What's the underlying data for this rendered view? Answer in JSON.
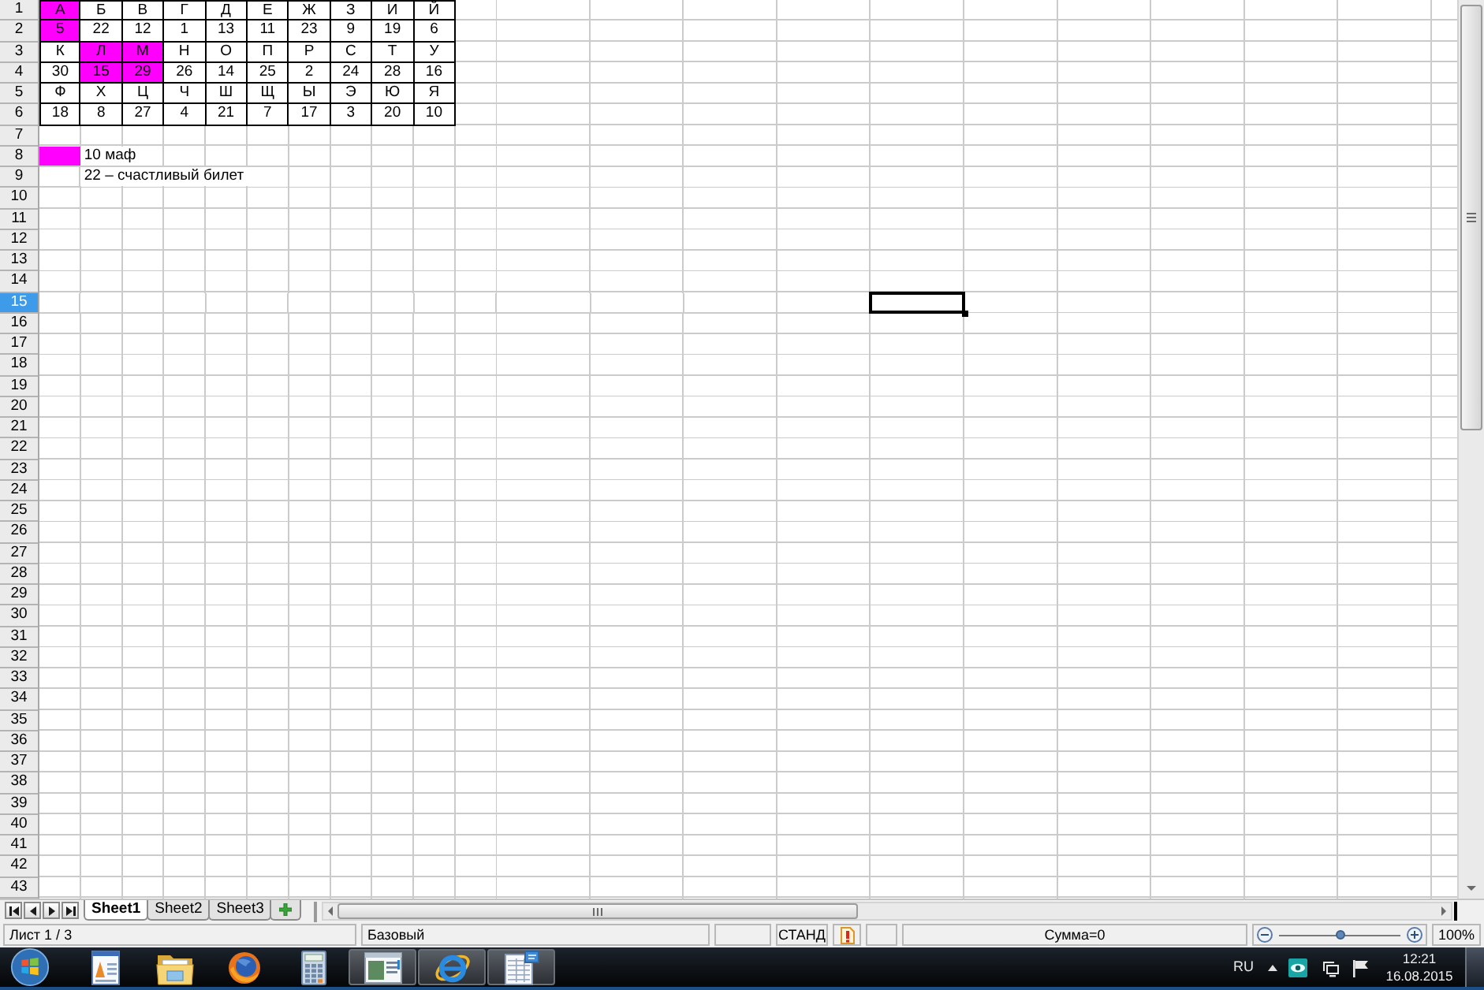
{
  "sheet": {
    "rows": [
      {
        "number": "1",
        "cells": [
          {
            "text": "А",
            "highlighted": true,
            "bordered": true,
            "selected": false
          },
          {
            "text": "Б",
            "highlighted": false,
            "bordered": true,
            "selected": false
          },
          {
            "text": "В",
            "highlighted": false,
            "bordered": true,
            "selected": false
          },
          {
            "text": "Г",
            "highlighted": false,
            "bordered": true,
            "selected": false
          },
          {
            "text": "Д",
            "highlighted": false,
            "bordered": true,
            "selected": false
          },
          {
            "text": "Е",
            "highlighted": false,
            "bordered": true,
            "selected": false
          },
          {
            "text": "Ж",
            "highlighted": false,
            "bordered": true,
            "selected": false
          },
          {
            "text": "З",
            "highlighted": false,
            "bordered": true,
            "selected": false
          },
          {
            "text": "И",
            "highlighted": false,
            "bordered": true,
            "selected": false
          },
          {
            "text": "Й",
            "highlighted": false,
            "bordered": true,
            "selected": false
          }
        ]
      },
      {
        "number": "2",
        "cells": [
          {
            "text": "5",
            "highlighted": true,
            "bordered": true,
            "selected": false
          },
          {
            "text": "22",
            "highlighted": false,
            "bordered": true,
            "selected": false
          },
          {
            "text": "12",
            "highlighted": false,
            "bordered": true,
            "selected": false
          },
          {
            "text": "1",
            "highlighted": false,
            "bordered": true,
            "selected": false
          },
          {
            "text": "13",
            "highlighted": false,
            "bordered": true,
            "selected": false
          },
          {
            "text": "11",
            "highlighted": false,
            "bordered": true,
            "selected": false
          },
          {
            "text": "23",
            "highlighted": false,
            "bordered": true,
            "selected": false
          },
          {
            "text": "9",
            "highlighted": false,
            "bordered": true,
            "selected": false
          },
          {
            "text": "19",
            "highlighted": false,
            "bordered": true,
            "selected": false
          },
          {
            "text": "6",
            "highlighted": false,
            "bordered": true,
            "selected": false
          }
        ]
      },
      {
        "number": "3",
        "cells": [
          {
            "text": "К",
            "highlighted": false,
            "bordered": true,
            "selected": false
          },
          {
            "text": "Л",
            "highlighted": true,
            "bordered": true,
            "selected": false
          },
          {
            "text": "М",
            "highlighted": true,
            "bordered": true,
            "selected": false
          },
          {
            "text": "Н",
            "highlighted": false,
            "bordered": true,
            "selected": false
          },
          {
            "text": "О",
            "highlighted": false,
            "bordered": true,
            "selected": false
          },
          {
            "text": "П",
            "highlighted": false,
            "bordered": true,
            "selected": false
          },
          {
            "text": "Р",
            "highlighted": false,
            "bordered": true,
            "selected": false
          },
          {
            "text": "С",
            "highlighted": false,
            "bordered": true,
            "selected": false
          },
          {
            "text": "Т",
            "highlighted": false,
            "bordered": true,
            "selected": false
          },
          {
            "text": "У",
            "highlighted": false,
            "bordered": true,
            "selected": false
          }
        ]
      },
      {
        "number": "4",
        "cells": [
          {
            "text": "30",
            "highlighted": false,
            "bordered": true,
            "selected": false
          },
          {
            "text": "15",
            "highlighted": true,
            "bordered": true,
            "selected": false
          },
          {
            "text": "29",
            "highlighted": true,
            "bordered": true,
            "selected": false
          },
          {
            "text": "26",
            "highlighted": false,
            "bordered": true,
            "selected": false
          },
          {
            "text": "14",
            "highlighted": false,
            "bordered": true,
            "selected": false
          },
          {
            "text": "25",
            "highlighted": false,
            "bordered": true,
            "selected": false
          },
          {
            "text": "2",
            "highlighted": false,
            "bordered": true,
            "selected": false
          },
          {
            "text": "24",
            "highlighted": false,
            "bordered": true,
            "selected": false
          },
          {
            "text": "28",
            "highlighted": false,
            "bordered": true,
            "selected": false
          },
          {
            "text": "16",
            "highlighted": false,
            "bordered": true,
            "selected": false
          }
        ]
      },
      {
        "number": "5",
        "cells": [
          {
            "text": "Ф",
            "highlighted": false,
            "bordered": true,
            "selected": false
          },
          {
            "text": "Х",
            "highlighted": false,
            "bordered": true,
            "selected": false
          },
          {
            "text": "Ц",
            "highlighted": false,
            "bordered": true,
            "selected": false
          },
          {
            "text": "Ч",
            "highlighted": false,
            "bordered": true,
            "selected": false
          },
          {
            "text": "Ш",
            "highlighted": false,
            "bordered": true,
            "selected": false
          },
          {
            "text": "Щ",
            "highlighted": false,
            "bordered": true,
            "selected": false
          },
          {
            "text": "Ы",
            "highlighted": false,
            "bordered": true,
            "selected": false
          },
          {
            "text": "Э",
            "highlighted": false,
            "bordered": true,
            "selected": false
          },
          {
            "text": "Ю",
            "highlighted": false,
            "bordered": true,
            "selected": false
          },
          {
            "text": "Я",
            "highlighted": false,
            "bordered": true,
            "selected": false
          }
        ]
      },
      {
        "number": "6",
        "cells": [
          {
            "text": "18",
            "highlighted": false,
            "bordered": true,
            "selected": false
          },
          {
            "text": "8",
            "highlighted": false,
            "bordered": true,
            "selected": false
          },
          {
            "text": "27",
            "highlighted": false,
            "bordered": true,
            "selected": false
          },
          {
            "text": "4",
            "highlighted": false,
            "bordered": true,
            "selected": false
          },
          {
            "text": "21",
            "highlighted": false,
            "bordered": true,
            "selected": false
          },
          {
            "text": "7",
            "highlighted": false,
            "bordered": true,
            "selected": false
          },
          {
            "text": "17",
            "highlighted": false,
            "bordered": true,
            "selected": false
          },
          {
            "text": "3",
            "highlighted": false,
            "bordered": true,
            "selected": false
          },
          {
            "text": "20",
            "highlighted": false,
            "bordered": true,
            "selected": false
          },
          {
            "text": "10",
            "highlighted": false,
            "bordered": true,
            "selected": false
          }
        ]
      },
      {
        "number": "7"
      },
      {
        "number": "8",
        "cells": [
          {
            "highlighted": true,
            "bordered": false,
            "selected": false
          },
          {
            "text": "10 маф",
            "highlighted": false,
            "bordered": false,
            "selected": false
          }
        ]
      },
      {
        "number": "9",
        "cells": [
          {
            "highlighted": false,
            "bordered": false,
            "selected": false
          },
          {
            "text": "22 – счастливый билет",
            "highlighted": false,
            "bordered": false,
            "selected": false
          }
        ]
      },
      {
        "number": "10"
      },
      {
        "number": "11"
      },
      {
        "number": "12"
      },
      {
        "number": "13"
      },
      {
        "number": "14"
      },
      {
        "number": "15",
        "cells": [
          {
            "highlighted": false,
            "bordered": false,
            "selected": false
          },
          {
            "highlighted": false,
            "bordered": false,
            "selected": false
          },
          {
            "highlighted": false,
            "bordered": false,
            "selected": false
          },
          {
            "highlighted": false,
            "bordered": false,
            "selected": false
          },
          {
            "highlighted": false,
            "bordered": false,
            "selected": false
          },
          {
            "highlighted": false,
            "bordered": false,
            "selected": false
          },
          {
            "highlighted": false,
            "bordered": false,
            "selected": false
          },
          {
            "highlighted": false,
            "bordered": false,
            "selected": false
          },
          {
            "highlighted": false,
            "bordered": false,
            "selected": false
          },
          {
            "highlighted": false,
            "bordered": false,
            "selected": false
          },
          {
            "highlighted": false,
            "bordered": false,
            "selected": false
          },
          {
            "highlighted": false,
            "bordered": false,
            "selected": false
          },
          {
            "highlighted": false,
            "bordered": false,
            "selected": false
          },
          {
            "highlighted": false,
            "bordered": false,
            "selected": false
          },
          {
            "highlighted": false,
            "bordered": false,
            "selected": false
          },
          {
            "highlighted": false,
            "bordered": false,
            "selected": true
          }
        ]
      },
      {
        "number": "16"
      },
      {
        "number": "17"
      },
      {
        "number": "18"
      },
      {
        "number": "19"
      },
      {
        "number": "20"
      },
      {
        "number": "21"
      },
      {
        "number": "22"
      },
      {
        "number": "23"
      },
      {
        "number": "24"
      },
      {
        "number": "25"
      },
      {
        "number": "26"
      },
      {
        "number": "27"
      },
      {
        "number": "28"
      },
      {
        "number": "29"
      },
      {
        "number": "30"
      },
      {
        "number": "31"
      },
      {
        "number": "32"
      },
      {
        "number": "33"
      },
      {
        "number": "34"
      },
      {
        "number": "35"
      },
      {
        "number": "36"
      },
      {
        "number": "37"
      },
      {
        "number": "38"
      },
      {
        "number": "39"
      },
      {
        "number": "40"
      },
      {
        "number": "41"
      },
      {
        "number": "42"
      },
      {
        "number": "43"
      }
    ]
  },
  "sheet_tabs": [
    {
      "label": "Sheet1",
      "selected": true
    },
    {
      "label": "Sheet2",
      "selected": false
    },
    {
      "label": "Sheet3",
      "selected": false
    }
  ],
  "status_bar": {
    "sheet_position": "Лист 1 / 3",
    "page_style": "Базовый",
    "selection_mode": "СТАНД",
    "modified": true,
    "sum": "Сумма=0",
    "zoom": {
      "level": 0.5,
      "reading": "100%"
    }
  },
  "taskbar": {
    "apps": [
      {
        "kind": "document",
        "running": false
      },
      {
        "kind": "folder",
        "running": false
      },
      {
        "kind": "globe",
        "running": false
      },
      {
        "kind": "calculator",
        "running": false
      },
      {
        "kind": "window",
        "running": true
      },
      {
        "kind": "ebrowser",
        "running": true
      },
      {
        "kind": "spreadsheet",
        "running": true
      }
    ],
    "language": "RU",
    "time": "12:21",
    "date": "16.08.2015"
  }
}
